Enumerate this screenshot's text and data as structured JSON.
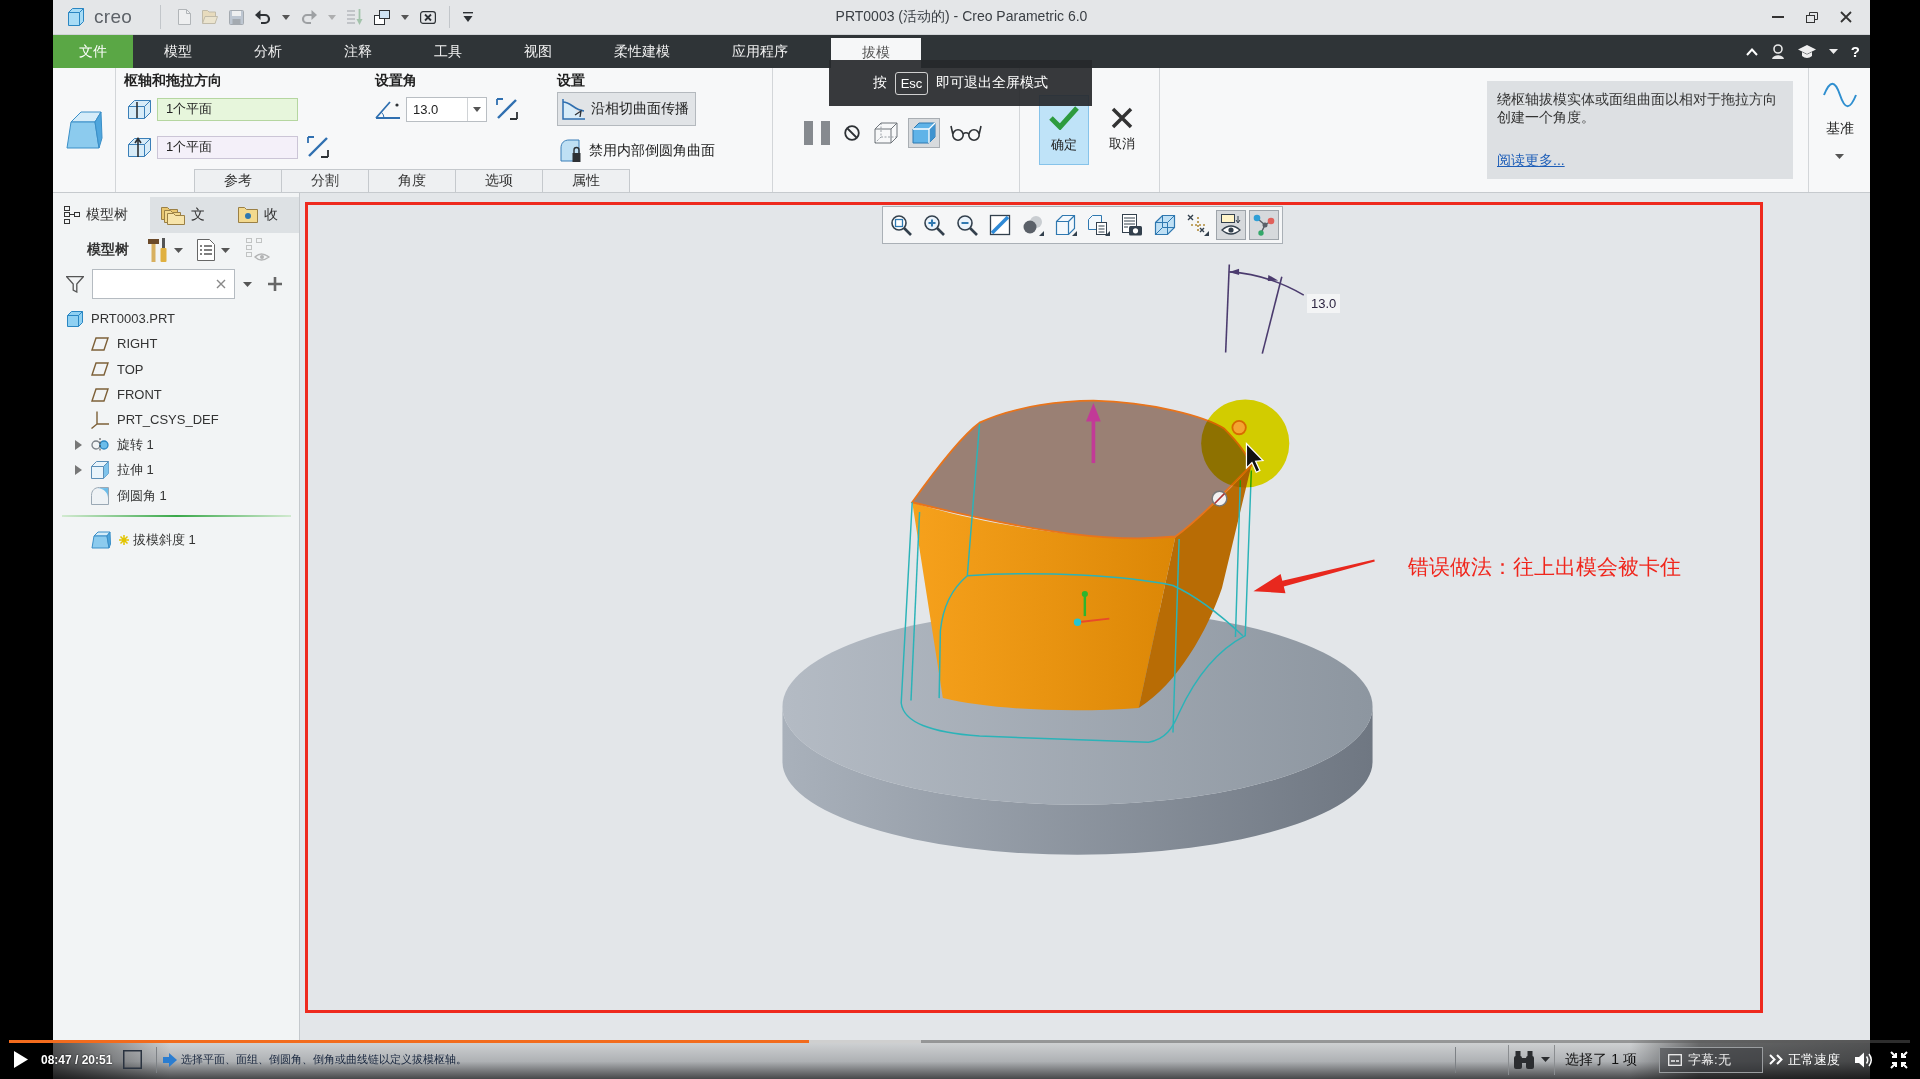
{
  "title_bar": {
    "logo": "creo",
    "quick_access": [
      {
        "kind": "new",
        "disabled": true
      },
      {
        "kind": "open",
        "disabled": true
      },
      {
        "kind": "save",
        "disabled": true
      },
      {
        "kind": "undo",
        "disabled": false
      },
      {
        "kind": "menu",
        "disabled": false
      },
      {
        "kind": "redo",
        "disabled": true
      },
      {
        "kind": "menu",
        "disabled": true
      },
      {
        "kind": "regenerate",
        "disabled": true
      },
      {
        "kind": "windows",
        "disabled": false
      },
      {
        "kind": "menu",
        "disabled": false
      },
      {
        "kind": "close",
        "disabled": false
      },
      {
        "kind": "separator"
      },
      {
        "kind": "customize",
        "disabled": false
      }
    ],
    "title": "PRT0003 (活动的) - Creo Parametric 6.0"
  },
  "menu_bar": {
    "tabs": [
      {
        "label": "文件",
        "kind": "file",
        "selected": false
      },
      {
        "label": "模型",
        "kind": "tab",
        "selected": false
      },
      {
        "label": "分析",
        "kind": "tab",
        "selected": false
      },
      {
        "label": "注释",
        "kind": "tab",
        "selected": false
      },
      {
        "label": "工具",
        "kind": "tab",
        "selected": false
      },
      {
        "label": "视图",
        "kind": "tab",
        "selected": false
      },
      {
        "label": "柔性建模",
        "kind": "tab",
        "selected": false
      },
      {
        "label": "应用程序",
        "kind": "tab",
        "selected": false
      },
      {
        "label": "拔模",
        "kind": "tab",
        "selected": true
      }
    ],
    "tools": [
      {
        "kind": "collapse"
      },
      {
        "kind": "search"
      },
      {
        "kind": "learning"
      },
      {
        "kind": "menu"
      },
      {
        "kind": "help",
        "label": "?"
      }
    ]
  },
  "dashboard": {
    "pivot_group": {
      "title": "枢轴和拖拉方向",
      "pivot": {
        "value": "1个平面",
        "active": true
      },
      "pull": {
        "value": "1个平面",
        "active": false
      }
    },
    "angle_group": {
      "title": "设置角",
      "value": "13.0"
    },
    "settings_group": {
      "title": "设置",
      "propagate": {
        "label": "沿相切曲面传播",
        "pressed": true
      },
      "exclude_rounds": {
        "label": "禁用内部倒圆角曲面",
        "pressed": false
      }
    },
    "panel_tabs": [
      "参考",
      "分割",
      "角度",
      "选项",
      "属性"
    ],
    "controls": [
      {
        "kind": "pause",
        "pressed": false
      },
      {
        "kind": "no-preview",
        "pressed": false
      },
      {
        "kind": "preview",
        "pressed": false
      },
      {
        "kind": "verify",
        "pressed": true
      },
      {
        "kind": "glasses",
        "pressed": false
      }
    ],
    "ok": "确定",
    "cancel": "取消",
    "help": {
      "text": "绕枢轴拔模实体或面组曲面以相对于拖拉方向创建一个角度。",
      "link": "阅读更多..."
    },
    "datum": "基准"
  },
  "fullscreen_hint": {
    "before": "按",
    "key": "Esc",
    "after": "即可退出全屏模式"
  },
  "navigator": {
    "tabs": [
      {
        "label": "模型树",
        "kind": "tree",
        "selected": true
      },
      {
        "label": "文",
        "kind": "folder",
        "selected": false
      },
      {
        "label": "收",
        "kind": "favorites",
        "selected": false
      }
    ],
    "title": "模型树",
    "tree": [
      {
        "label": "PRT0003.PRT",
        "kind": "part",
        "children": [
          {
            "label": "RIGHT",
            "kind": "plane",
            "in_progress": false
          },
          {
            "label": "TOP",
            "kind": "plane",
            "in_progress": false
          },
          {
            "label": "FRONT",
            "kind": "plane",
            "in_progress": false
          },
          {
            "label": "PRT_CSYS_DEF",
            "kind": "csys",
            "in_progress": false
          },
          {
            "label": "旋转 1",
            "kind": "revolve",
            "expanded": false,
            "in_progress": false
          },
          {
            "label": "拉伸 1",
            "kind": "extrude",
            "expanded": false,
            "in_progress": false
          },
          {
            "label": "倒圆角 1",
            "kind": "round",
            "in_progress": false
          },
          {
            "label": "拔模斜度 1",
            "kind": "draft",
            "in_progress": true
          }
        ]
      }
    ]
  },
  "canvas": {
    "toolbar": [
      {
        "kind": "refit",
        "pressed": false
      },
      {
        "kind": "zoom-in",
        "pressed": false
      },
      {
        "kind": "zoom-out",
        "pressed": false
      },
      {
        "kind": "repaint",
        "pressed": false
      },
      {
        "kind": "display-style",
        "pressed": false
      },
      {
        "kind": "saved-orientations",
        "pressed": false
      },
      {
        "kind": "view-manager",
        "pressed": false
      },
      {
        "kind": "snapshot",
        "pressed": false
      },
      {
        "kind": "perspective",
        "pressed": false
      },
      {
        "kind": "datum-display",
        "pressed": false
      },
      {
        "kind": "annotation-display",
        "pressed": true
      },
      {
        "kind": "spin-center",
        "pressed": true
      }
    ],
    "dimension": "13.0",
    "note": "错误做法：往上出模会被卡住"
  },
  "status_bar": {
    "message": "选择平面、面组、倒圆角、倒角或曲线链以定义拔模枢轴。",
    "selection": "选择了 1 项"
  },
  "player": {
    "paused": true,
    "time": "08:47 / 20:51",
    "progress": {
      "level": 0.421
    },
    "buffer": {
      "level": 0.48
    },
    "subtitles": "字幕:无",
    "speed": "正常速度"
  }
}
